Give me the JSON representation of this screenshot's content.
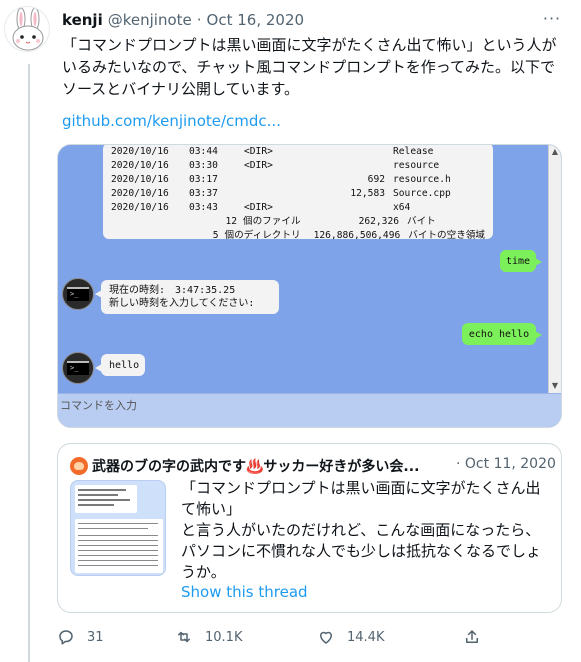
{
  "tweet": {
    "name": "kenji",
    "handle": "@kenjinote",
    "separator": "·",
    "date": "Oct 16, 2020",
    "more": "···",
    "text_lines": [
      "「コマンドプロンプトは黒い画面に文字がたくさん出て怖い」という人が",
      "いるみたいなので、チャット風コマンドプロンプトを作ってみた。以下で",
      "ソースとバイナリ公開しています。"
    ],
    "link": "github.com/kenjinote/cmdc..."
  },
  "media": {
    "dir_rows": [
      {
        "date": "2020/10/16",
        "time": "03:44",
        "type": "<DIR>",
        "size": "",
        "name": "Release"
      },
      {
        "date": "2020/10/16",
        "time": "03:30",
        "type": "<DIR>",
        "size": "",
        "name": "resource"
      },
      {
        "date": "2020/10/16",
        "time": "03:17",
        "type": "",
        "size": "692",
        "name": "resource.h"
      },
      {
        "date": "2020/10/16",
        "time": "03:37",
        "type": "",
        "size": "12,583",
        "name": "Source.cpp"
      },
      {
        "date": "2020/10/16",
        "time": "03:43",
        "type": "<DIR>",
        "size": "",
        "name": "x64"
      }
    ],
    "summary_rows": [
      {
        "count": "12",
        "label": "個のファイル",
        "size": "262,326",
        "unit": "バイト"
      },
      {
        "count": "5",
        "label": "個のディレクトリ",
        "size": "126,886,506,496",
        "unit": "バイトの空き領域"
      }
    ],
    "msg_time": "time",
    "reply_time_line1": "現在の時刻:　3:47:35.25",
    "reply_time_line2": "新しい時刻を入力してください:",
    "msg_echo": "echo hello",
    "reply_echo": "hello",
    "avatar_glyph": ">_",
    "input_placeholder": "コマンドを入力",
    "scroll_up": "▲",
    "scroll_down": "▼"
  },
  "quote": {
    "name": "武器のブの字の武内です♨️サッカー好きが多い会...",
    "separator": "·",
    "date": "Oct 11, 2020",
    "text_lines": [
      "「コマンドプロンプトは黒い画面に文字がたくさん出",
      "て怖い」",
      "と言う人がいたのだけれど、こんな画面になったら、",
      "パソコンに不慣れな人でも少しは抵抗なくなるでしょ",
      "うか。"
    ],
    "show_thread": "Show this thread"
  },
  "actions": {
    "replies": "31",
    "retweets": "10.1K",
    "likes": "14.4K"
  },
  "icons": {
    "reply": "reply-icon",
    "retweet": "retweet-icon",
    "like": "heart-icon",
    "share": "share-icon",
    "more": "more-icon"
  },
  "colors": {
    "accent": "#1d9bf0",
    "chat_background": "#7fa3e8",
    "outgoing_bubble": "#7cf05a",
    "incoming_bubble": "#f3f3f3"
  }
}
